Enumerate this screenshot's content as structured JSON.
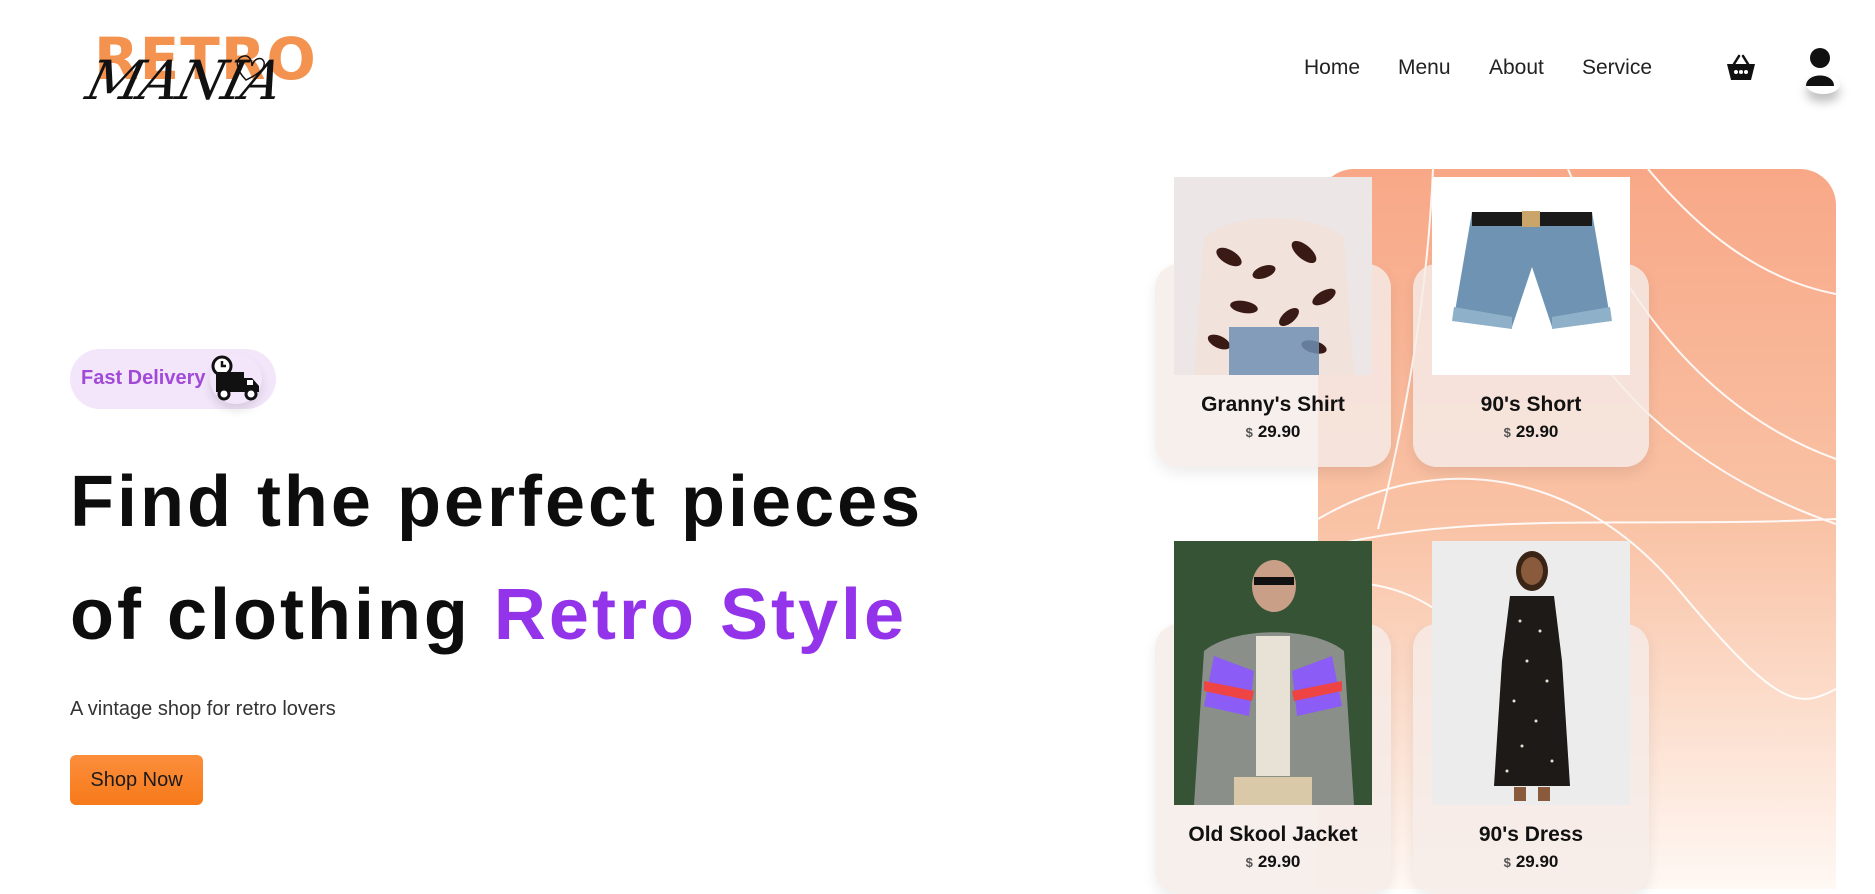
{
  "brand": {
    "logo_word1": "RETRO",
    "logo_word2": "MANIA"
  },
  "nav": {
    "items": [
      "Home",
      "Menu",
      "About",
      "Service"
    ]
  },
  "icons": {
    "cart": "basket-icon",
    "user": "user-icon",
    "delivery": "delivery-truck-icon"
  },
  "hero": {
    "badge": "Fast Delivery",
    "title_line1": "Find the perfect pieces",
    "title_line2": "of clothing ",
    "title_accent": "Retro Style",
    "subtitle": "A vintage shop for retro lovers",
    "cta": "Shop Now"
  },
  "products": [
    {
      "name": "Granny's Shirt",
      "currency": "$",
      "price": "29.90"
    },
    {
      "name": "90's Short",
      "currency": "$",
      "price": "29.90"
    },
    {
      "name": "Old Skool Jacket",
      "currency": "$",
      "price": "29.90"
    },
    {
      "name": "90's Dress",
      "currency": "$",
      "price": "29.90"
    }
  ],
  "colors": {
    "accent": "#9333ea",
    "brand_orange": "#f4934f",
    "button": "#f77a1a",
    "badge_bg": "#f3e6fb"
  }
}
